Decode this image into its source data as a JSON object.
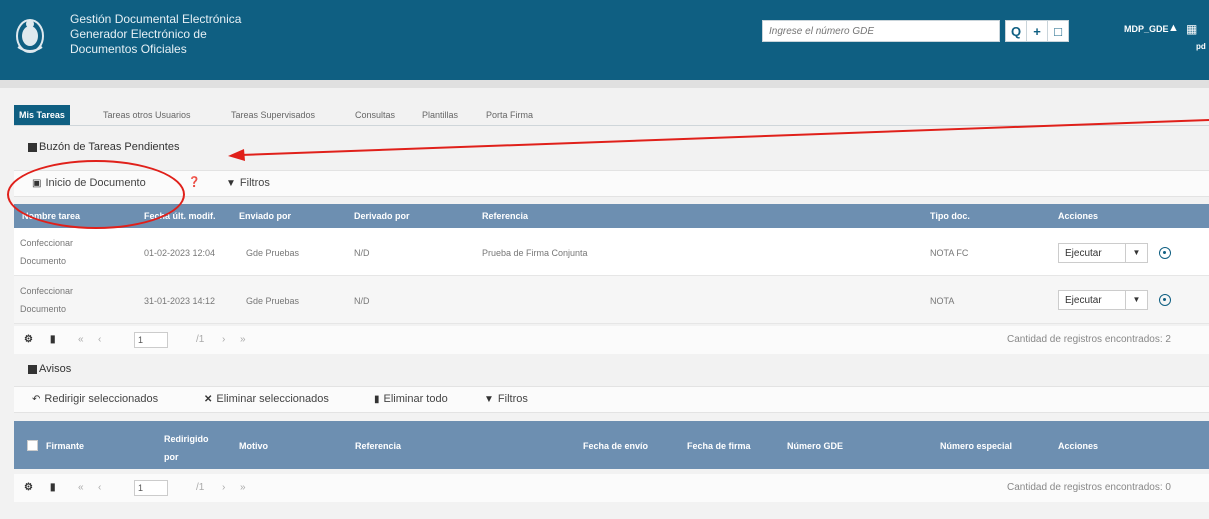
{
  "header": {
    "title_lines": [
      "Gestión Documental Electrónica",
      "Generador Electrónico de",
      "Documentos Oficiales"
    ],
    "search_placeholder": "Ingrese el número GDE",
    "search_btn": "Q",
    "add_btn": "+",
    "user": "MDP_GDE",
    "user_sub": "pd"
  },
  "tabs": [
    "Mis Tareas",
    "Tareas otros Usuarios",
    "Tareas Supervisados",
    "Consultas",
    "Plantillas",
    "Porta Firma"
  ],
  "tasks": {
    "title": "Buzón de Tareas Pendientes",
    "toolbar": {
      "inicio": "Inicio de Documento",
      "filtros": "Filtros"
    },
    "columns": [
      "Nombre tarea",
      "Fecha últ. modif.",
      "Enviado por",
      "Derivado por",
      "Referencia",
      "Tipo doc.",
      "Acciones"
    ],
    "rows": [
      {
        "tarea_l1": "Confeccionar",
        "tarea_l2": "Documento",
        "fecha": "01-02-2023 12:04",
        "enviado": "Gde Pruebas",
        "derivado": "N/D",
        "referencia": "Prueba de Firma Conjunta",
        "tipo": "NOTA FC",
        "accion": "Ejecutar"
      },
      {
        "tarea_l1": "Confeccionar",
        "tarea_l2": "Documento",
        "fecha": "31-01-2023 14:12",
        "enviado": "Gde Pruebas",
        "derivado": "N/D",
        "referencia": "",
        "tipo": "NOTA",
        "accion": "Ejecutar"
      }
    ],
    "pager": {
      "page": "1",
      "of": "/1",
      "count": "Cantidad de registros encontrados: 2"
    }
  },
  "avisos": {
    "title": "Avisos",
    "toolbar": {
      "redirigir": "Redirigir seleccionados",
      "eliminar_sel": "Eliminar seleccionados",
      "eliminar_todo": "Eliminar todo",
      "filtros": "Filtros"
    },
    "columns": {
      "firmante": "Firmante",
      "redirigido_l1": "Redirigido",
      "redirigido_l2": "por",
      "motivo": "Motivo",
      "referencia": "Referencia",
      "fecha_envio": "Fecha de envío",
      "fecha_firma": "Fecha de firma",
      "numero_gde": "Número GDE",
      "numero_especial": "Número especial",
      "acciones": "Acciones"
    },
    "pager": {
      "page": "1",
      "of": "/1",
      "count": "Cantidad de registros encontrados: 0"
    }
  },
  "colors": {
    "header": "#0f5f82",
    "table_header": "#6d8fb1",
    "annotation": "#e0201a"
  }
}
